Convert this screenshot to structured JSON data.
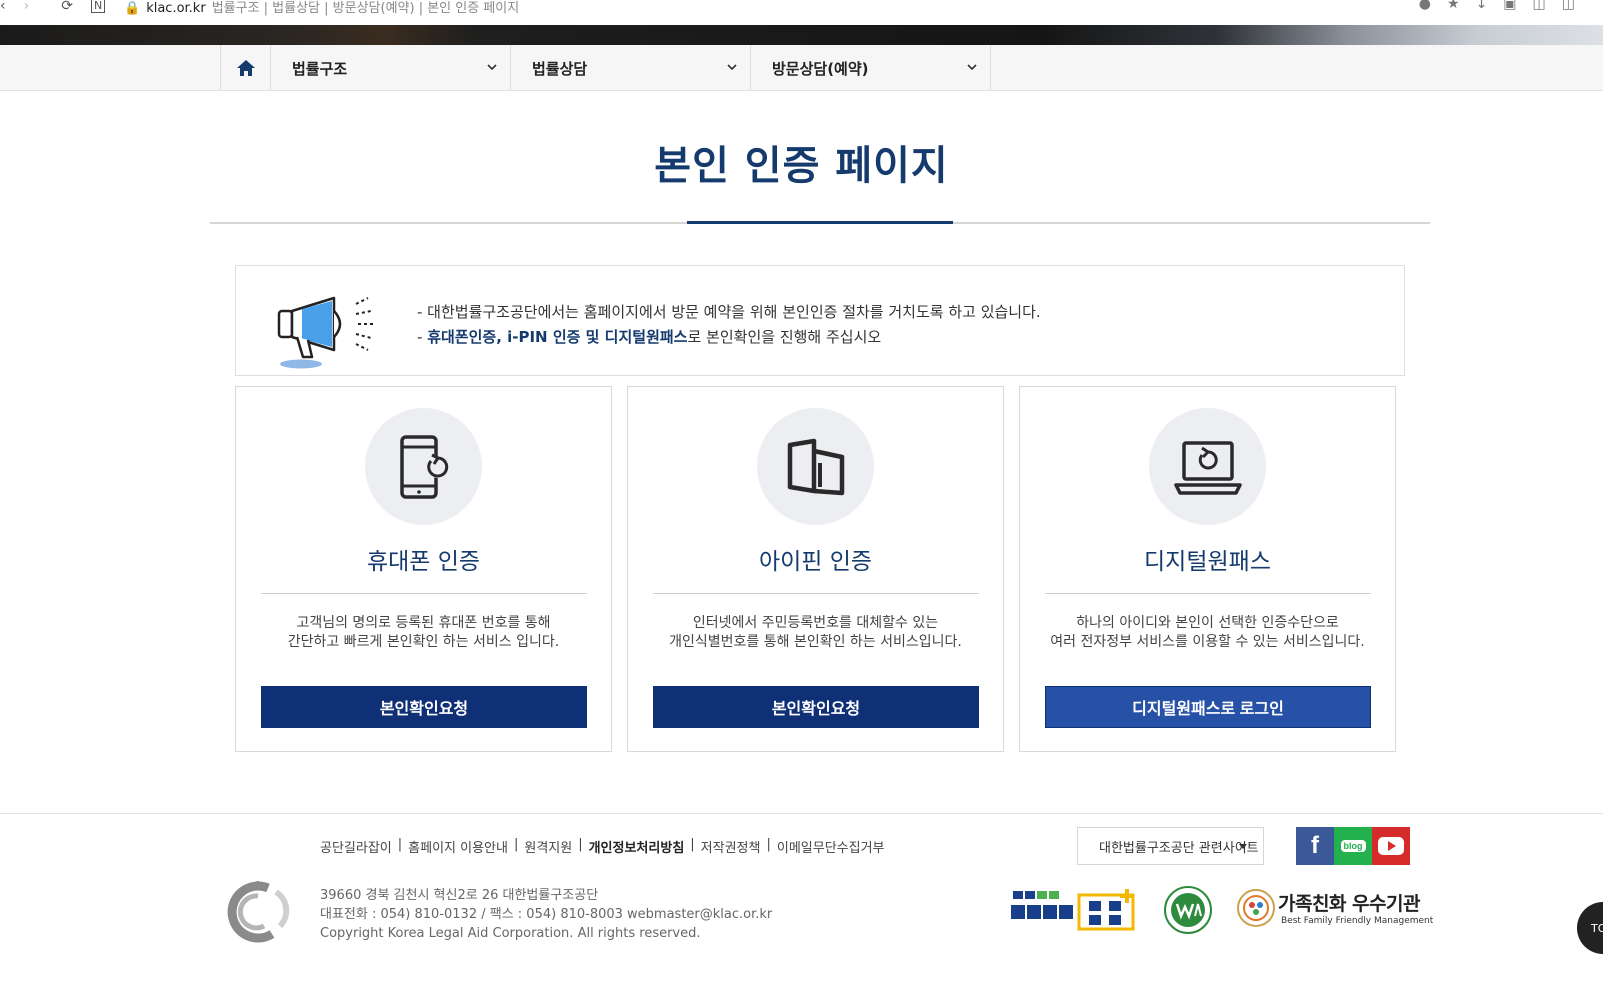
{
  "browser": {
    "domain": "klac.or.kr",
    "page_path": "법률구조 | 법률상담 | 방문상담(예약) | 본인 인증 페이지"
  },
  "nav": {
    "home_icon": "home-icon",
    "items": [
      {
        "label": "법률구조"
      },
      {
        "label": "법률상담"
      },
      {
        "label": "방문상담(예약)"
      }
    ]
  },
  "page": {
    "title": "본인 인증 페이지"
  },
  "notice": {
    "icon": "megaphone-icon",
    "line1": "- 대한법률구조공단에서는 홈페이지에서 방문 예약을 위해 본인인증 절차를 거치도록 하고 있습니다.",
    "line2_prefix": "- ",
    "line2_highlight": "휴대폰인증, i-PIN 인증 및 디지털원패스",
    "line2_suffix": "로 본인확인을 진행해 주십시오"
  },
  "cards": [
    {
      "icon": "mobile-phone-icon",
      "title": "휴대폰 인증",
      "desc1": "고객님의 명의로 등록된 휴대폰 번호를 통해",
      "desc2": "간단하고 빠르게 본인확인 하는 서비스 입니다.",
      "button": "본인확인요청"
    },
    {
      "icon": "ipin-card-icon",
      "title": "아이핀 인증",
      "desc1": "인터넷에서 주민등록번호를 대체할수 있는",
      "desc2": "개인식별번호를 통해 본인확인 하는 서비스입니다.",
      "button": "본인확인요청"
    },
    {
      "icon": "laptop-icon",
      "title": "디지털원패스",
      "desc1": "하나의 아이디와 본인이 선택한 인증수단으로",
      "desc2": "여러 전자정부 서비스를 이용할 수 있는 서비스입니다.",
      "button": "디지털원패스로 로그인"
    }
  ],
  "footer": {
    "links": [
      "공단길라잡이",
      "홈페이지 이용안내",
      "원격지원",
      "개인정보처리방침",
      "저작권정책",
      "이메일무단수집거부"
    ],
    "related_sites": "대한법률구조공단 관련사이트",
    "social": {
      "facebook": "f",
      "blog": "blog",
      "youtube": "youtube-icon"
    },
    "address": "39660 경북 김천시 혁신2로 26 대한법률구조공단",
    "contact": "대표전화 : 054) 810-0132 / 팩스 : 054) 810-8003 webmaster@klac.or.kr",
    "copyright": "Copyright Korea Legal Aid Corporation. All rights reserved.",
    "badge_family_title": "가족친화 우수기관",
    "badge_family_sub": "Best Family Friendly Management",
    "top_button": "TO"
  },
  "colors": {
    "primary": "#143a6e",
    "button": "#0f3076",
    "button_alt": "#2750a7",
    "facebook": "#3b5998",
    "blog": "#22b14c",
    "youtube": "#d52b2b"
  }
}
